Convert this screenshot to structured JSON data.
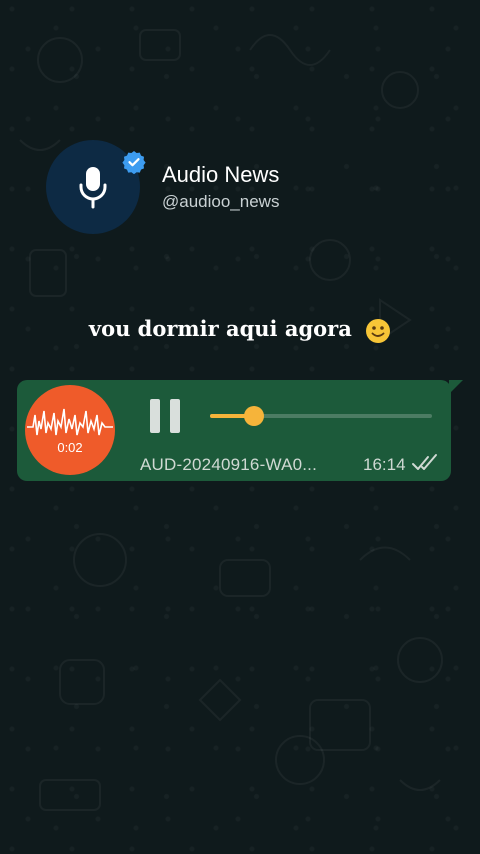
{
  "channel": {
    "name": "Audio News",
    "handle": "@audioo_news"
  },
  "caption": "vou dormir aqui agora",
  "audio_message": {
    "duration": "0:02",
    "filename": "AUD-20240916-WA0...",
    "time": "16:14",
    "progress": 0.2,
    "state": "playing"
  },
  "colors": {
    "background": "#0f1a1c",
    "bubble": "#1c5a3a",
    "accent": "#f6b43a",
    "thumb": "#ef5b2a",
    "verified": "#3d9cf0"
  },
  "icons": {
    "avatar": "microphone-icon",
    "badge": "verified-badge-icon",
    "control": "pause-icon",
    "status": "double-check-icon",
    "caption_emoji": "slightly-smiling-face-emoji"
  }
}
